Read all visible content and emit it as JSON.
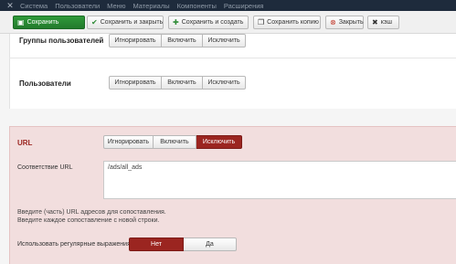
{
  "nav": {
    "logo_icon": "joomla-icon",
    "items": [
      "Система",
      "Пользователи",
      "Меню",
      "Материалы",
      "Компоненты",
      "Расширения"
    ]
  },
  "toolbar": {
    "save": "Сохранить",
    "save_close": "Сохранить и закрыть",
    "save_new": "Сохранить и создать",
    "save_copy": "Сохранить копию",
    "close": "Закрыть",
    "cache": "кэш"
  },
  "user_groups": {
    "label": "Группы пользователей",
    "options": [
      "Игнорировать",
      "Включить",
      "Исключить"
    ]
  },
  "users": {
    "label": "Пользователи",
    "options": [
      "Игнорировать",
      "Включить",
      "Исключить"
    ]
  },
  "url": {
    "label": "URL",
    "options": [
      "Игнорировать",
      "Включить",
      "Исключить"
    ],
    "selected": "Исключить",
    "match_label": "Соответствие URL",
    "match_value": "/ads/all_ads",
    "help_line1": "Введите (часть) URL адресов для сопоставления.",
    "help_line2": "Введите каждое сопоставление с новой строки.",
    "regex_label": "Использовать регулярные выражения",
    "regex_no": "Нет",
    "regex_yes": "Да",
    "regex_selected": "Нет"
  },
  "colors": {
    "navbar": "#1e2b3c",
    "save_green": "#2f9a3a",
    "active_red": "#9b2520",
    "panel_pink": "#f2dede"
  }
}
